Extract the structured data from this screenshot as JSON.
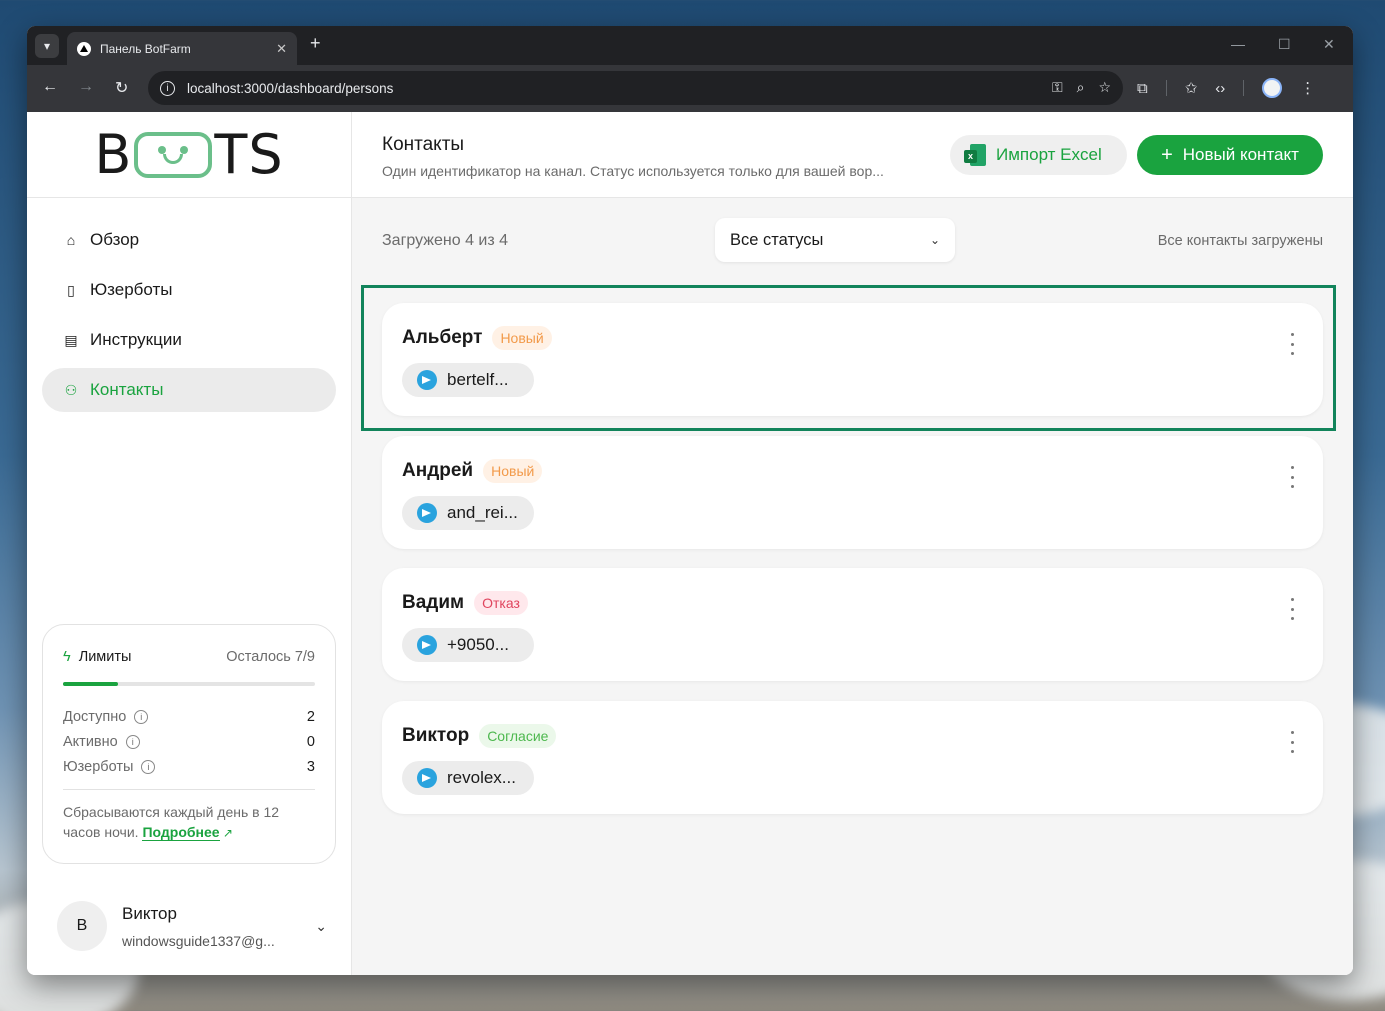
{
  "browser": {
    "tab_title": "Панель BotFarm",
    "url": "localhost:3000/dashboard/persons"
  },
  "sidebar": {
    "logo": {
      "left": "B",
      "right": "TS"
    },
    "items": [
      {
        "label": "Обзор",
        "icon": "home-icon",
        "active": false
      },
      {
        "label": "Юзерботы",
        "icon": "phone-icon",
        "active": false
      },
      {
        "label": "Инструкции",
        "icon": "document-icon",
        "active": false
      },
      {
        "label": "Контакты",
        "icon": "users-icon",
        "active": true
      }
    ],
    "limits": {
      "title": "Лимиты",
      "remaining": "Осталось 7/9",
      "progress": 0.22,
      "rows": [
        {
          "label": "Доступно",
          "value": "2"
        },
        {
          "label": "Активно",
          "value": "0"
        },
        {
          "label": "Юзерботы",
          "value": "3"
        }
      ],
      "note": "Сбрасываются каждый день в 12 часов ночи.",
      "link": "Подробнее"
    },
    "user": {
      "initial": "В",
      "name": "Виктор",
      "email": "windowsguide1337@g..."
    }
  },
  "header": {
    "title": "Контакты",
    "subtitle": "Один идентификатор на канал. Статус используется только для вашей вор...",
    "import_label": "Импорт Excel",
    "new_label": "Новый контакт"
  },
  "filter": {
    "loaded": "Загружено 4 из 4",
    "status_select": "Все статусы",
    "all_loaded": "Все контакты загружены"
  },
  "contacts": [
    {
      "name": "Альберт",
      "status": "Новый",
      "status_type": "new",
      "handle": "bertelf..."
    },
    {
      "name": "Андрей",
      "status": "Новый",
      "status_type": "new",
      "handle": "and_rei..."
    },
    {
      "name": "Вадим",
      "status": "Отказ",
      "status_type": "refuse",
      "handle": "+9050..."
    },
    {
      "name": "Виктор",
      "status": "Согласие",
      "status_type": "agree",
      "handle": "revolex..."
    }
  ],
  "colors": {
    "accent": "#1aa33f",
    "highlight_border": "#12845b",
    "telegram": "#2aa3de"
  }
}
